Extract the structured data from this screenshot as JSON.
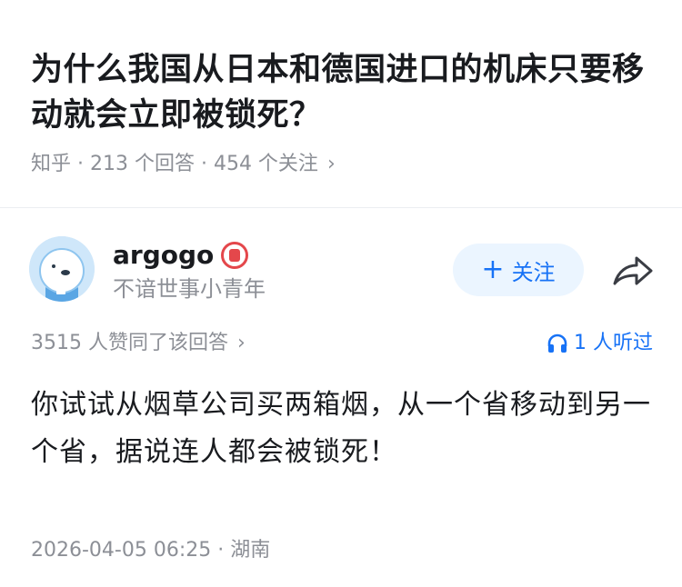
{
  "question": {
    "title": "为什么我国从日本和德国进口的机床只要移动就会立即被锁死？",
    "meta": "知乎 · 213 个回答 · 454 个关注",
    "meta_chevron": "›"
  },
  "author": {
    "name": "argogo",
    "bio": "不谙世事小青年",
    "follow_label": "关注",
    "follow_plus": "+"
  },
  "answer": {
    "likes_text": "3515 人赞同了该回答",
    "likes_chevron": "›",
    "listened_text": "1 人听过",
    "content": "你试试从烟草公司买两箱烟，从一个省移动到另一个省，据说连人都会被锁死！",
    "footer": "2026-04-05 06:25 · 湖南"
  },
  "icons": {
    "share": "share-arrow-icon",
    "headphones": "headphones-icon",
    "badge": "creator-badge-icon"
  },
  "colors": {
    "accent": "#1772f6",
    "muted": "#8c8f96",
    "text": "#191b1f",
    "follow_bg": "#ebf5ff",
    "badge": "#e4474b"
  }
}
